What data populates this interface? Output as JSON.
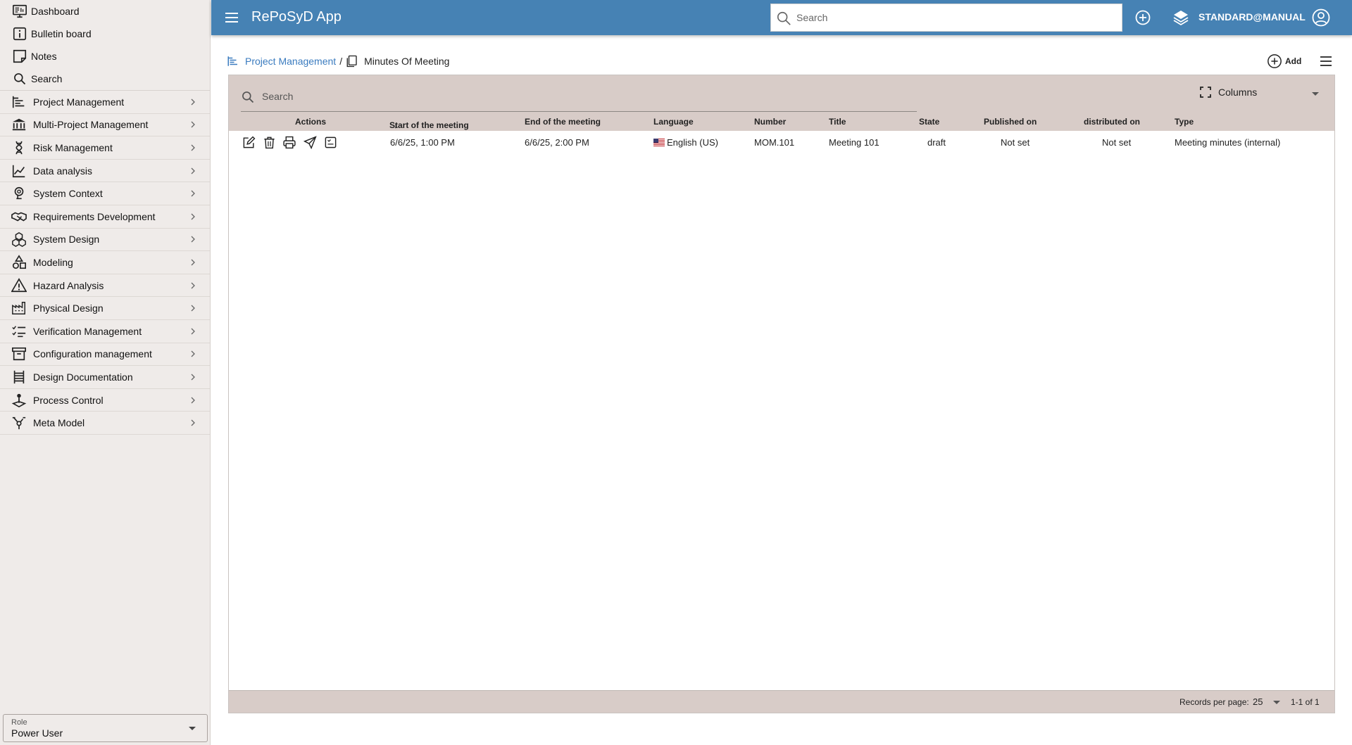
{
  "sidebar": {
    "top_items": [
      {
        "label": "Dashboard",
        "icon": "monitor-dashboard-icon"
      },
      {
        "label": "Bulletin board",
        "icon": "info-board-icon"
      },
      {
        "label": "Notes",
        "icon": "note-icon"
      },
      {
        "label": "Search",
        "icon": "search-icon"
      }
    ],
    "groups": [
      {
        "label": "Project Management",
        "icon": "tree-list-icon"
      },
      {
        "label": "Multi-Project Management",
        "icon": "bank-icon"
      },
      {
        "label": "Risk Management",
        "icon": "dna-icon"
      },
      {
        "label": "Data analysis",
        "icon": "line-chart-icon"
      },
      {
        "label": "System Context",
        "icon": "head-icon"
      },
      {
        "label": "Requirements Development",
        "icon": "handshake-icon"
      },
      {
        "label": "System Design",
        "icon": "cubes-icon"
      },
      {
        "label": "Modeling",
        "icon": "shapes-icon"
      },
      {
        "label": "Hazard Analysis",
        "icon": "warning-icon"
      },
      {
        "label": "Physical Design",
        "icon": "factory-icon"
      },
      {
        "label": "Verification Management",
        "icon": "checklist-icon"
      },
      {
        "label": "Configuration management",
        "icon": "archive-icon"
      },
      {
        "label": "Design Documentation",
        "icon": "ladder-icon"
      },
      {
        "label": "Process Control",
        "icon": "joystick-icon"
      },
      {
        "label": "Meta Model",
        "icon": "hub-icon"
      }
    ],
    "role": {
      "label": "Role",
      "value": "Power User"
    }
  },
  "header": {
    "title": "RePoSyD App",
    "search_placeholder": "Search",
    "user": "STANDARD@MANUAL",
    "accent": "#4682b4"
  },
  "breadcrumb": {
    "parent": "Project Management",
    "separator": "/",
    "current": "Minutes Of Meeting"
  },
  "toolbar": {
    "add_label": "Add"
  },
  "table": {
    "search_placeholder": "Search",
    "columns_label": "Columns",
    "headers": {
      "actions": "Actions",
      "start": "Start of the meeting",
      "end": "End of the meeting",
      "language": "Language",
      "number": "Number",
      "title": "Title",
      "state": "State",
      "published": "Published on",
      "distributed": "distributed on",
      "type": "Type"
    },
    "sort": {
      "column": "start",
      "direction": "descending"
    },
    "rows": [
      {
        "start": "6/6/25, 1:00 PM",
        "end": "6/6/25, 2:00 PM",
        "language": "English (US)",
        "number": "MOM.101",
        "title": "Meeting 101",
        "state": "draft",
        "published": "Not set",
        "distributed": "Not set",
        "type": "Meeting minutes (internal)"
      }
    ],
    "footer": {
      "records_label": "Records per page:",
      "records_value": "25",
      "range": "1-1 of 1"
    },
    "header_bg": "#d8ccc8"
  }
}
